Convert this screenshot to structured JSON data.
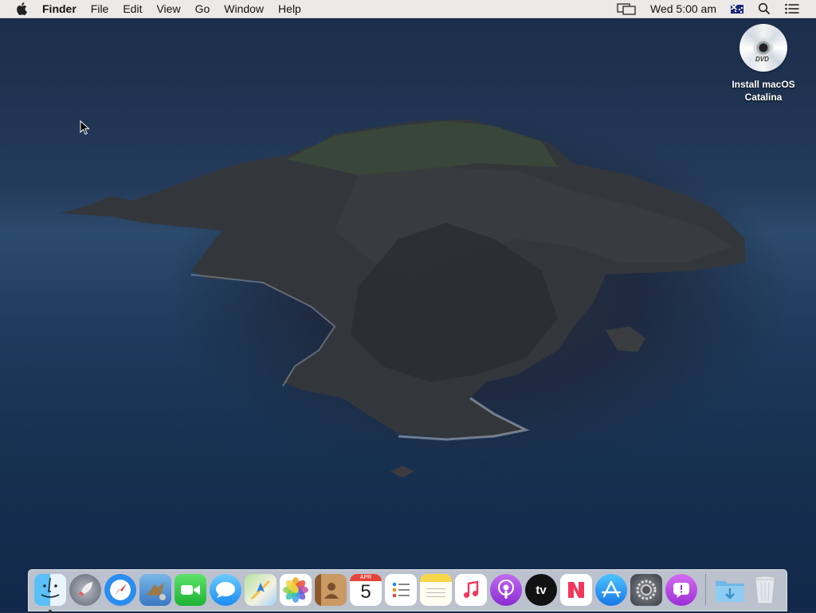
{
  "menubar": {
    "app_name": "Finder",
    "menus": [
      "File",
      "Edit",
      "View",
      "Go",
      "Window",
      "Help"
    ],
    "clock": "Wed 5:00 am",
    "icons": [
      "apple-icon",
      "display-mirroring-icon",
      "input-source-flag-icon",
      "spotlight-icon",
      "notification-center-icon"
    ]
  },
  "desktop": {
    "icons": [
      {
        "label": "Install macOS Catalina",
        "icon": "dvd-icon",
        "badge": "DVD"
      }
    ]
  },
  "dock": {
    "apps": [
      {
        "name": "finder",
        "icon": "finder-icon",
        "running": true
      },
      {
        "name": "launchpad",
        "icon": "launchpad-icon",
        "running": false
      },
      {
        "name": "safari",
        "icon": "safari-icon",
        "running": false
      },
      {
        "name": "mail",
        "icon": "mail-icon",
        "running": false
      },
      {
        "name": "facetime",
        "icon": "facetime-icon",
        "running": false
      },
      {
        "name": "messages",
        "icon": "messages-icon",
        "running": false
      },
      {
        "name": "maps",
        "icon": "maps-icon",
        "running": false
      },
      {
        "name": "photos",
        "icon": "photos-icon",
        "running": false
      },
      {
        "name": "contacts",
        "icon": "contacts-icon",
        "running": false
      },
      {
        "name": "calendar",
        "icon": "calendar-icon",
        "running": false,
        "month": "APR",
        "day": "5"
      },
      {
        "name": "reminders",
        "icon": "reminders-icon",
        "running": false
      },
      {
        "name": "notes",
        "icon": "notes-icon",
        "running": false
      },
      {
        "name": "music",
        "icon": "music-icon",
        "running": false
      },
      {
        "name": "podcasts",
        "icon": "podcasts-icon",
        "running": false
      },
      {
        "name": "tv",
        "icon": "tv-icon",
        "running": false,
        "label": "tv"
      },
      {
        "name": "news",
        "icon": "news-icon",
        "running": false
      },
      {
        "name": "app-store",
        "icon": "app-store-icon",
        "running": false
      },
      {
        "name": "system-preferences",
        "icon": "system-preferences-icon",
        "running": false
      },
      {
        "name": "feedback-assistant",
        "icon": "feedback-assistant-icon",
        "running": false
      }
    ],
    "stacks": [
      {
        "name": "downloads",
        "icon": "downloads-folder-icon"
      },
      {
        "name": "trash",
        "icon": "trash-icon"
      }
    ]
  }
}
